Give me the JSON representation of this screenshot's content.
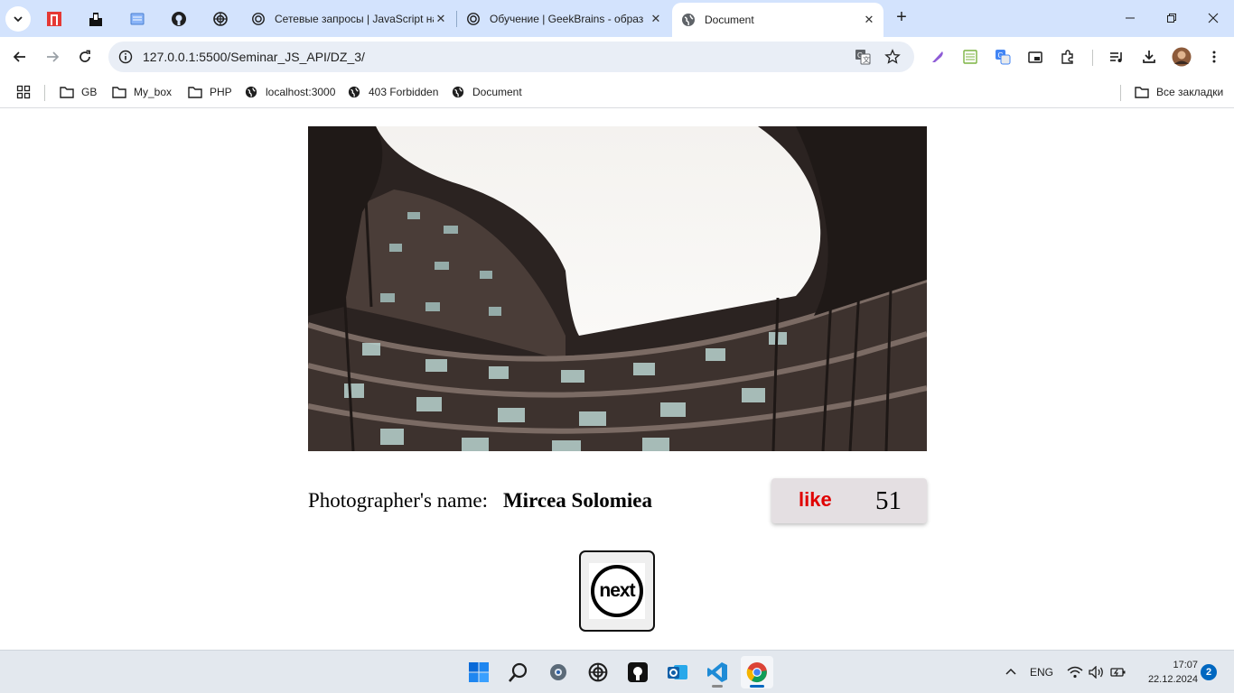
{
  "browser": {
    "tabs": [
      {
        "title": "Сетевые запросы | JavaScript на",
        "icon": "openai-icon"
      },
      {
        "title": "Обучение | GeekBrains - образ",
        "icon": "openai-icon"
      },
      {
        "title": "Document",
        "icon": "globe-icon",
        "active": true
      }
    ],
    "new_tab": "+",
    "close_glyph": "✕",
    "address": {
      "url": "127.0.0.1:5500/Seminar_JS_API/DZ_3/"
    },
    "bookmarks": [
      {
        "label": "GB",
        "icon": "folder-icon"
      },
      {
        "label": "My_box",
        "icon": "folder-icon"
      },
      {
        "label": "PHP",
        "icon": "folder-icon"
      },
      {
        "label": "localhost:3000",
        "icon": "globe-icon"
      },
      {
        "label": "403 Forbidden",
        "icon": "globe-icon"
      },
      {
        "label": "Document",
        "icon": "globe-icon"
      }
    ],
    "all_bookmarks": "Все закладки"
  },
  "page": {
    "photographer_label": "Photographer's name:",
    "photographer_name": "Mircea Solomiea",
    "like_label": "like",
    "like_count": "51",
    "next_label": "next"
  },
  "taskbar": {
    "language": "ENG",
    "time": "17:07",
    "date": "22.12.2024",
    "notifications": "2"
  },
  "colors": {
    "tabstrip": "#d3e3fd",
    "like_text": "#e00000",
    "like_box": "#e4dfe2"
  }
}
